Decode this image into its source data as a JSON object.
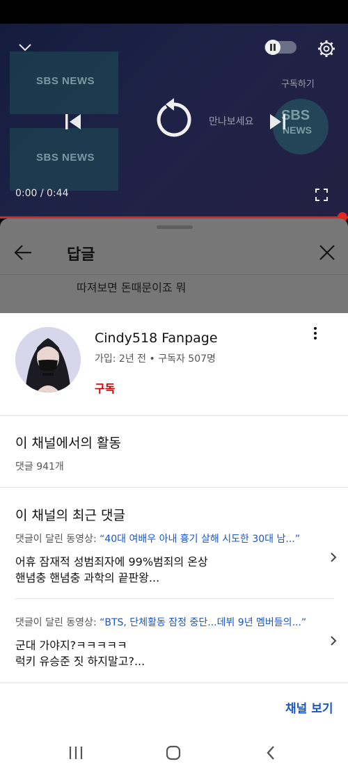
{
  "player": {
    "tiles": [
      "SBS NEWS",
      "SBS NEWS"
    ],
    "subscribe_ghost": "구독하기",
    "overlay_text": "만나보세요",
    "time": "0:00 / 0:44",
    "logo_text": "SBS NEWS",
    "progress": 1.0
  },
  "replies": {
    "title": "답글",
    "preview_text": "따져보면 돈때문이죠 뭐"
  },
  "channel": {
    "name": "Cindy518 Fanpage",
    "meta": "가입: 2년 전 • 구독자 507명",
    "subscribe_label": "구독"
  },
  "activity": {
    "title": "이 채널에서의 활동",
    "count": "댓글 941개"
  },
  "recent": {
    "title": "이 채널의 최근 댓글",
    "comments": [
      {
        "prefix": "댓글이 달린 동영상: ",
        "video_title": "“40대 여배우 아내 흉기 살해 시도한 30대 남...”",
        "line1": "어휴 잠재적 성범죄자에 99%범죄의 온상",
        "line2": "핸념충 핸념충 과학의 끝판왕..."
      },
      {
        "prefix": "댓글이 달린 동영상: ",
        "video_title": "“BTS, 단체활동 잠정 중단...데뷔 9년 멤버들의...”",
        "line1": "군대 가야지?ㅋㅋㅋㅋㅋ",
        "line2": "럭키 유승준 짓 하지말고?..."
      }
    ]
  },
  "footer": {
    "view_channel": "채널 보기"
  },
  "colors": {
    "accent_red": "#cc0000",
    "link_blue": "#1a56c4",
    "progress_red": "#e0281e"
  },
  "icons": [
    "chevron-down-icon",
    "pause-toggle-icon",
    "gear-icon",
    "skip-previous-icon",
    "replay-icon",
    "skip-next-icon",
    "fullscreen-icon",
    "back-arrow-icon",
    "close-icon",
    "more-vert-icon",
    "chevron-right-icon",
    "recents-icon",
    "home-icon",
    "back-icon"
  ]
}
